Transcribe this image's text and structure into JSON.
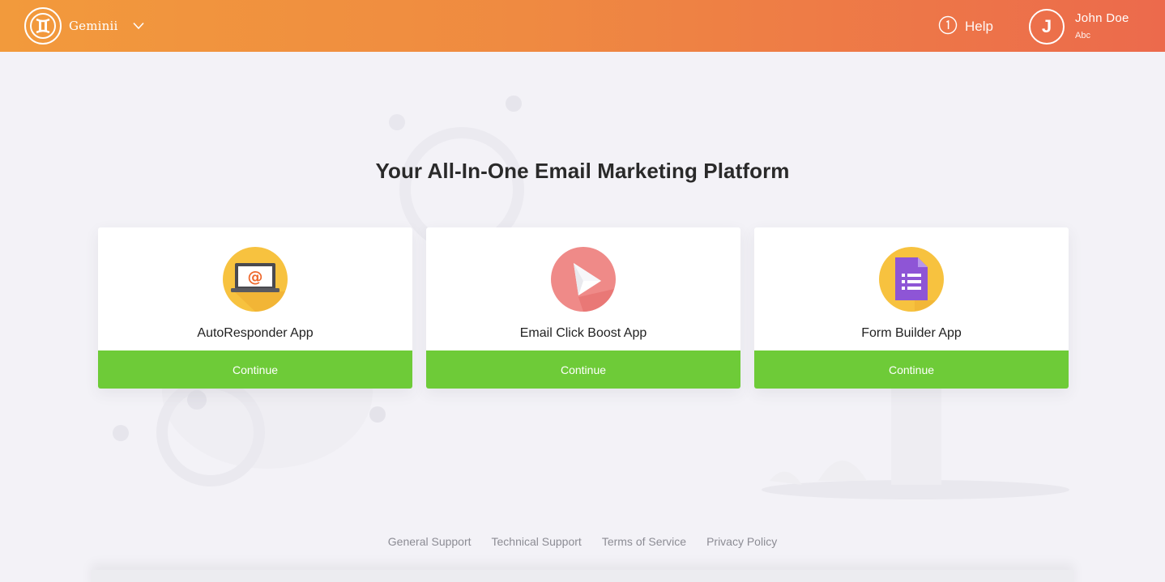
{
  "header": {
    "brand_name": "Geminii",
    "help_label": "Help",
    "user": {
      "initial": "J",
      "name": "John Doe",
      "subtitle": "Abc"
    }
  },
  "hero": {
    "title": "Your All-In-One Email Marketing Platform"
  },
  "apps": [
    {
      "title": "AutoResponder App",
      "button": "Continue",
      "icon": "laptop-email-icon",
      "icon_bg": "#f7c23f"
    },
    {
      "title": "Email Click Boost App",
      "button": "Continue",
      "icon": "paper-plane-icon",
      "icon_bg": "#ef8a88"
    },
    {
      "title": "Form Builder App",
      "button": "Continue",
      "icon": "form-document-icon",
      "icon_bg": "#f7c23f"
    }
  ],
  "footer": {
    "links": [
      "General Support",
      "Technical Support",
      "Terms of Service",
      "Privacy Policy"
    ]
  },
  "colors": {
    "header_start": "#f29a3c",
    "header_end": "#ec6a4c",
    "continue_green": "#6ecb38",
    "page_bg": "#f3f2f7"
  }
}
